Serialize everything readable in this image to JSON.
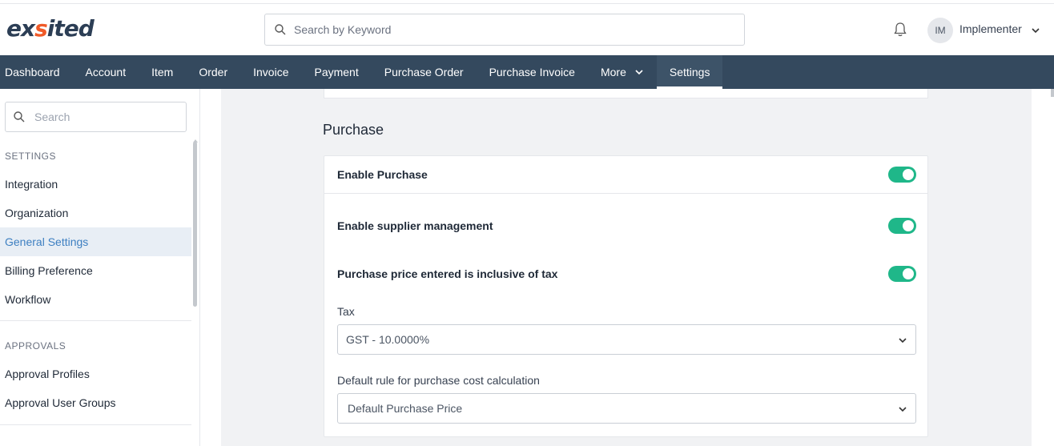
{
  "brand": {
    "logo_text_pre": "ex",
    "logo_text_accent": "s",
    "logo_text_post": "ited"
  },
  "header": {
    "search_placeholder": "Search by Keyword",
    "avatar_initials": "IM",
    "user_name": "Implementer"
  },
  "nav": {
    "items": [
      {
        "label": "Dashboard"
      },
      {
        "label": "Account"
      },
      {
        "label": "Item"
      },
      {
        "label": "Order"
      },
      {
        "label": "Invoice"
      },
      {
        "label": "Payment"
      },
      {
        "label": "Purchase Order"
      },
      {
        "label": "Purchase Invoice"
      },
      {
        "label": "More"
      },
      {
        "label": "Settings"
      }
    ],
    "active": "Settings"
  },
  "sidebar": {
    "search_placeholder": "Search",
    "sections": [
      {
        "title": "SETTINGS",
        "items": [
          {
            "label": "Integration"
          },
          {
            "label": "Organization"
          },
          {
            "label": "General Settings"
          },
          {
            "label": "Billing Preference"
          },
          {
            "label": "Workflow"
          }
        ]
      },
      {
        "title": "APPROVALS",
        "items": [
          {
            "label": "Approval Profiles"
          },
          {
            "label": "Approval User Groups"
          }
        ]
      }
    ],
    "active_item": "General Settings"
  },
  "main": {
    "section_title": "Purchase",
    "enable_purchase": {
      "label": "Enable Purchase",
      "on": true
    },
    "supplier_management": {
      "label": "Enable supplier management",
      "on": true
    },
    "inclusive_tax": {
      "label": "Purchase price entered is inclusive of tax",
      "on": true
    },
    "tax": {
      "label": "Tax",
      "value": "GST - 10.0000%"
    },
    "cost_rule": {
      "label": "Default rule for purchase cost calculation",
      "value": "Default Purchase Price"
    }
  },
  "colors": {
    "nav_bg": "#34495e",
    "toggle_on": "#1fb789",
    "active_link": "#3d7fc1",
    "logo_accent": "#f05a28"
  },
  "icons": [
    "search-icon",
    "bell-icon",
    "chevron-down-icon"
  ]
}
